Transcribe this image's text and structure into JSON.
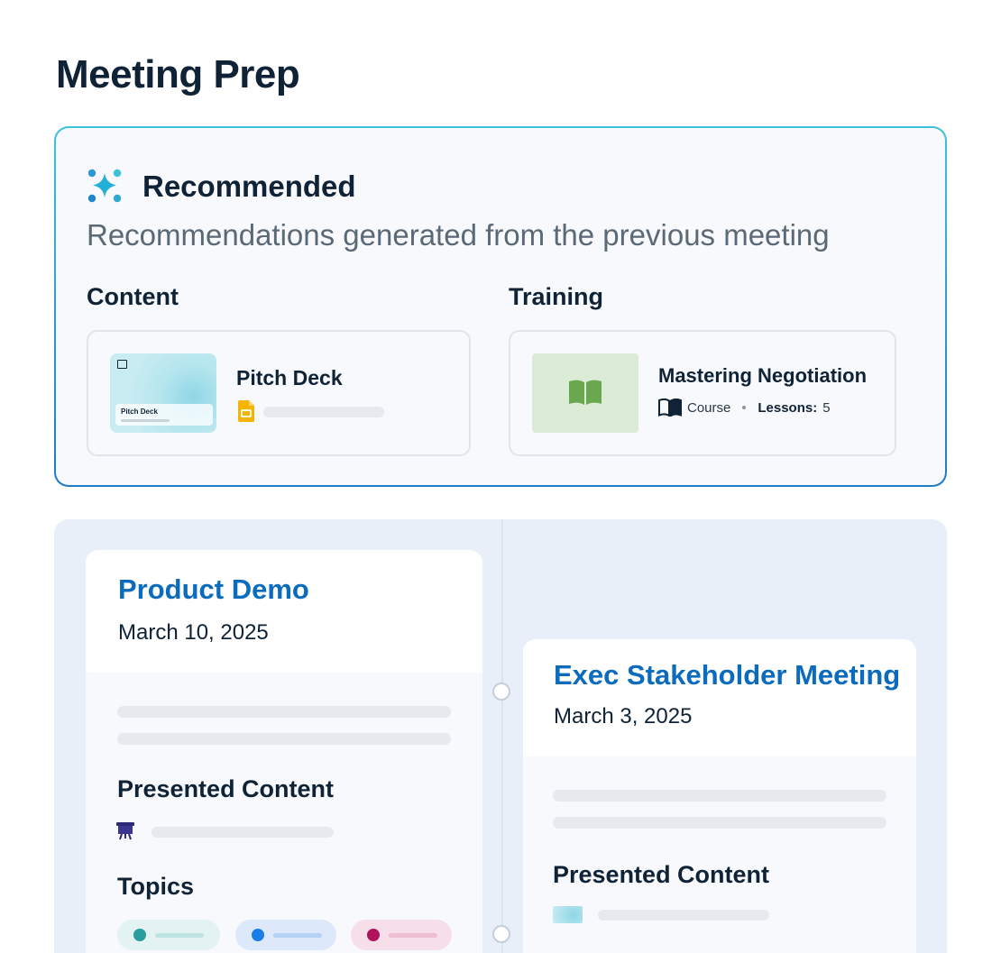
{
  "page": {
    "title": "Meeting Prep"
  },
  "recommended": {
    "icon": "sparkle-icon",
    "title": "Recommended",
    "subtitle": "Recommendations generated from the previous meeting",
    "content": {
      "label": "Content",
      "item": {
        "title": "Pitch Deck",
        "thumbnail_text": "Pitch Deck",
        "file_icon": "google-slides-icon"
      }
    },
    "training": {
      "label": "Training",
      "item": {
        "title": "Mastering Negotiation",
        "type_icon": "book-icon",
        "type": "Course",
        "lessons_label": "Lessons:",
        "lessons_count": "5"
      }
    }
  },
  "timeline": {
    "meetings": [
      {
        "title": "Product Demo",
        "date": "March 10, 2025",
        "presented_content_label": "Presented Content",
        "presented_icon": "presentation-icon",
        "topics_label": "Topics",
        "topic_colors": [
          "#2a9d9d",
          "#1a7ee6",
          "#b0125d"
        ]
      },
      {
        "title": "Exec Stakeholder Meeting",
        "date": "March 3, 2025",
        "presented_content_label": "Presented Content",
        "presented_icon": "slide-thumbnail-icon"
      }
    ]
  },
  "colors": {
    "accent_blue": "#0b6bbd",
    "border_gradient_start": "#3dc3d8",
    "border_gradient_end": "#1f7ac7",
    "timeline_bg": "#e8eff9"
  }
}
